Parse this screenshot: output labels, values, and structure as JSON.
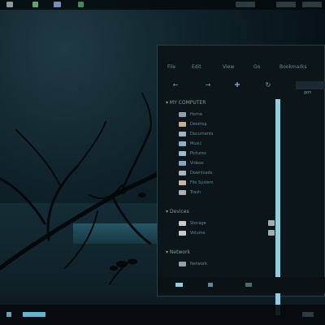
{
  "colors": {
    "accent": "#8fd0e0",
    "window_bg": "#0c1519",
    "text": "#6c8890",
    "wallpaper": "#0f2229"
  },
  "topbar": {
    "items": [
      "top-icon-1",
      "top-icon-2",
      "top-icon-3",
      "top-icon-4"
    ]
  },
  "file_manager": {
    "menu": [
      "File",
      "Edit",
      "View",
      "Go",
      "Bookmarks"
    ],
    "toolbar": {
      "back_icon": "back-icon",
      "forward_icon": "forward-icon",
      "up_icon": "up-icon",
      "reload_icon": "reload-icon",
      "path_label": "gon"
    },
    "sidebar": {
      "sections": [
        {
          "title": "MY COMPUTER",
          "items": [
            "Home",
            "Desktop",
            "Documents",
            "Music",
            "Pictures",
            "Videos",
            "Downloads",
            "File System",
            "Trash"
          ]
        },
        {
          "title": "Devices",
          "items": [
            "Storage",
            "Volume"
          ]
        },
        {
          "title": "Network",
          "items": [
            "Network"
          ]
        }
      ]
    },
    "statusbar": {
      "icons": [
        "places-icon",
        "tree-icon",
        "close-sidebar-icon"
      ]
    }
  },
  "taskbar": {
    "items": [
      "menu-icon",
      "active-window-task",
      "clock"
    ]
  }
}
